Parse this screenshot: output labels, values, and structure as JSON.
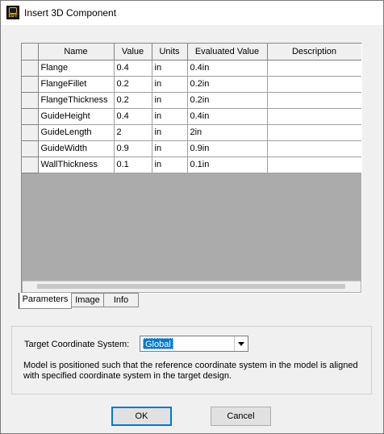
{
  "window": {
    "title": "Insert 3D Component",
    "icon_text": "EDT"
  },
  "table": {
    "headers": [
      "Name",
      "Value",
      "Units",
      "Evaluated Value",
      "Description"
    ],
    "rows": [
      {
        "name": "Flange",
        "value": "0.4",
        "units": "in",
        "evaluated": "0.4in",
        "description": ""
      },
      {
        "name": "FlangeFillet",
        "value": "0.2",
        "units": "in",
        "evaluated": "0.2in",
        "description": ""
      },
      {
        "name": "FlangeThickness",
        "value": "0.2",
        "units": "in",
        "evaluated": "0.2in",
        "description": ""
      },
      {
        "name": "GuideHeight",
        "value": "0.4",
        "units": "in",
        "evaluated": "0.4in",
        "description": ""
      },
      {
        "name": "GuideLength",
        "value": "2",
        "units": "in",
        "evaluated": "2in",
        "description": ""
      },
      {
        "name": "GuideWidth",
        "value": "0.9",
        "units": "in",
        "evaluated": "0.9in",
        "description": ""
      },
      {
        "name": "WallThickness",
        "value": "0.1",
        "units": "in",
        "evaluated": "0.1in",
        "description": ""
      }
    ]
  },
  "tabs": [
    {
      "label": "Parameters",
      "active": true
    },
    {
      "label": "Image",
      "active": false
    },
    {
      "label": "Info",
      "active": false
    }
  ],
  "coordinate": {
    "label": "Target Coordinate System:",
    "selected": "Global",
    "note": "Model is positioned such that the reference coordinate system in the model is aligned with specified coordinate system in the target design."
  },
  "buttons": {
    "ok": "OK",
    "cancel": "Cancel"
  },
  "colors": {
    "selection": "#0078d7",
    "default_button_border": "#0078d7",
    "grid_background": "#ababab"
  }
}
